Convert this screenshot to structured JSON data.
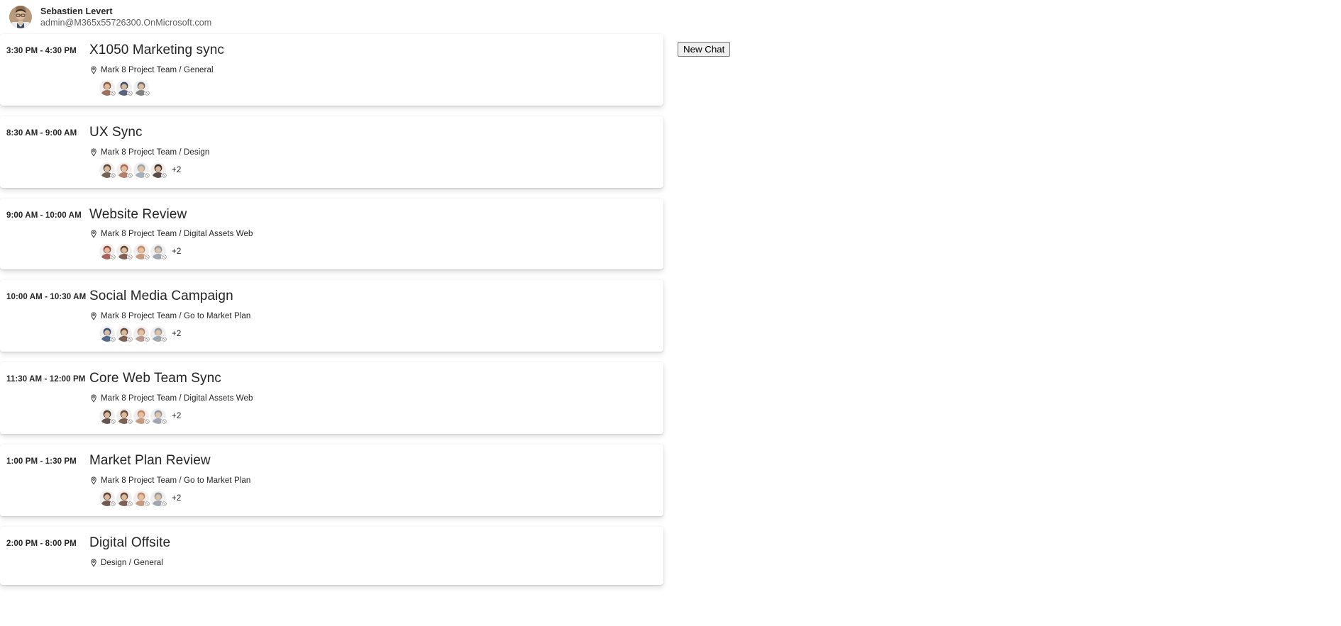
{
  "persona": {
    "name": "Sebastien Levert",
    "email": "admin@M365x55726300.OnMicrosoft.com",
    "avatar_icon": "user-photo-avatar"
  },
  "toolbar": {
    "new_chat_label": "New Chat"
  },
  "icons": {
    "location_pin": "location-pin-icon",
    "presence_unknown": "presence-unknown-icon"
  },
  "colors": {
    "text_primary": "#252423",
    "text_secondary": "#605e5c",
    "card_background": "#ffffff",
    "page_background": "#ffffff",
    "button_face": "#efefef",
    "button_border": "#767676"
  },
  "agenda": {
    "events": [
      {
        "time": "3:30 PM - 4:30 PM",
        "title": "X1050 Marketing sync",
        "location": "Mark 8 Project Team / General",
        "attendee_count": 3,
        "overflow": "",
        "avatar_colors": [
          "#8a5a44",
          "#3b4a68",
          "#6e6e72"
        ]
      },
      {
        "time": "8:30 AM - 9:00 AM",
        "title": "UX Sync",
        "location": "Mark 8 Project Team / Design",
        "attendee_count": 4,
        "overflow": "+2",
        "avatar_colors": [
          "#5b4a3c",
          "#a96a52",
          "#9aa3ad",
          "#3d2f28"
        ]
      },
      {
        "time": "9:00 AM - 10:00 AM",
        "title": "Website Review",
        "location": "Mark 8 Project Team / Digital Assets Web",
        "attendee_count": 4,
        "overflow": "+2",
        "avatar_colors": [
          "#9c4a42",
          "#6b4636",
          "#c08a6a",
          "#8f99a6"
        ]
      },
      {
        "time": "10:00 AM - 10:30 AM",
        "title": "Social Media Campaign",
        "location": "Mark 8 Project Team / Go to Market Plan",
        "attendee_count": 4,
        "overflow": "+2",
        "avatar_colors": [
          "#35507a",
          "#6b4636",
          "#b08a78",
          "#8f99a6"
        ]
      },
      {
        "time": "11:30 AM - 12:00 PM",
        "title": "Core Web Team Sync",
        "location": "Mark 8 Project Team / Digital Assets Web",
        "attendee_count": 4,
        "overflow": "+2",
        "avatar_colors": [
          "#4a3b32",
          "#6b4636",
          "#c08a6a",
          "#8f99a6"
        ]
      },
      {
        "time": "1:00 PM - 1:30 PM",
        "title": "Market Plan Review",
        "location": "Mark 8 Project Team / Go to Market Plan",
        "attendee_count": 4,
        "overflow": "+2",
        "avatar_colors": [
          "#5a4038",
          "#6b4636",
          "#c08a6a",
          "#8f99a6"
        ]
      },
      {
        "time": "2:00 PM - 8:00 PM",
        "title": "Digital Offsite",
        "location": "Design / General",
        "attendee_count": 0,
        "overflow": "",
        "avatar_colors": []
      }
    ]
  }
}
